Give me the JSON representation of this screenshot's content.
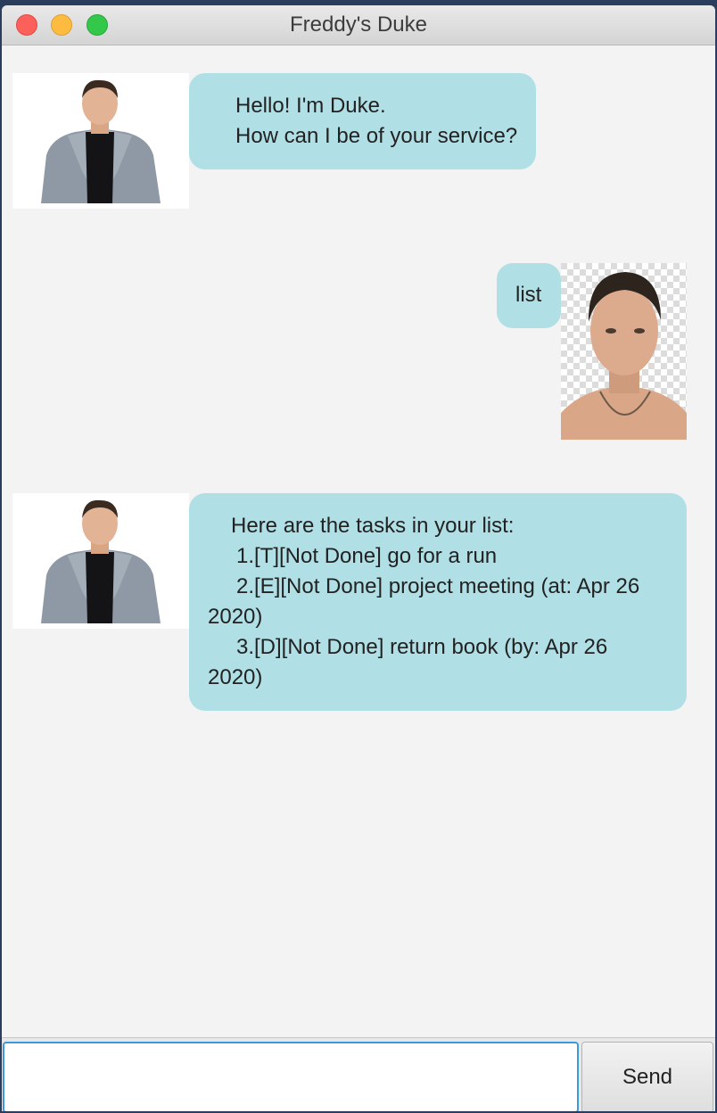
{
  "window": {
    "title": "Freddy's Duke"
  },
  "dialog": {
    "messages": [
      {
        "sender": "duke",
        "lines": [
          "Hello! I'm Duke.",
          "How can I be of your service?"
        ]
      },
      {
        "sender": "user",
        "lines": [
          "list"
        ]
      },
      {
        "sender": "duke",
        "lines": [
          "Here are the tasks in your list:",
          "1.[T][Not Done] go for a run",
          "2.[E][Not Done] project meeting (at: Apr 26 2020)",
          "3.[D][Not Done] return book (by: Apr 26 2020)"
        ]
      }
    ]
  },
  "input": {
    "value": "",
    "placeholder": ""
  },
  "send_button": {
    "label": "Send"
  },
  "colors": {
    "bubble": "#b0dfe5",
    "background": "#f3f3f3",
    "input_focus": "#3b9ad9"
  }
}
